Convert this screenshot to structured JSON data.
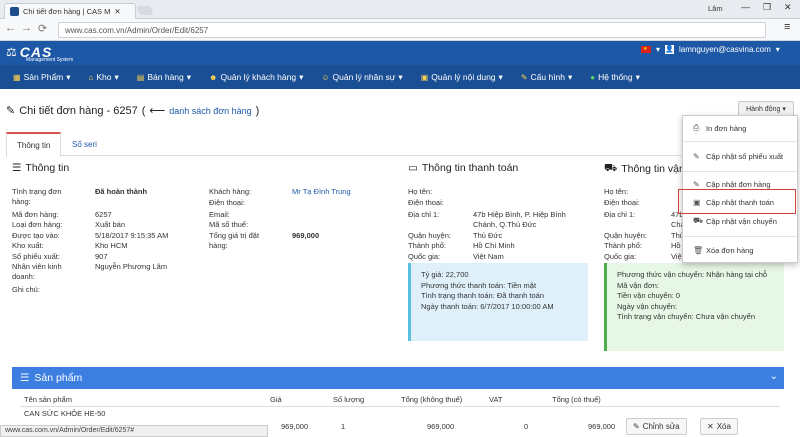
{
  "browser": {
    "tab_title": "Chi tiết đơn hàng | CAS M",
    "user": "Lâm",
    "url": "www.cas.com.vn/Admin/Order/Edit/6257",
    "status_url": "www.cas.com.vn/Admin/Order/Edit/6257#"
  },
  "app": {
    "logo": "CAS",
    "logo_sub": "Management System",
    "account": "lamnguyen@casvina.com"
  },
  "nav": [
    {
      "label": "Sản Phẩm"
    },
    {
      "label": "Kho"
    },
    {
      "label": "Bán hàng"
    },
    {
      "label": "Quản lý khách hàng"
    },
    {
      "label": "Quản lý nhân sự"
    },
    {
      "label": "Quản lý nội dung"
    },
    {
      "label": "Cấu hình"
    },
    {
      "label": "Hệ thống"
    }
  ],
  "page": {
    "title": "Chi tiết đơn hàng - 6257",
    "back_link": "danh sách đơn hàng",
    "action_button": "Hành động",
    "tabs": [
      "Thông tin",
      "Số seri"
    ]
  },
  "info": {
    "title": "Thông tin",
    "left": [
      {
        "label": "Tình trạng đơn hàng:",
        "value": "Đã hoàn thành"
      },
      {
        "label": "Mã đơn hàng:",
        "value": "6257"
      },
      {
        "label": "Loại đơn hàng:",
        "value": "Xuất bán"
      },
      {
        "label": "Được tạo vào:",
        "value": "5/18/2017 9:15:35 AM"
      },
      {
        "label": "Kho xuất:",
        "value": "Kho HCM"
      },
      {
        "label": "Số phiếu xuất:",
        "value": "907"
      },
      {
        "label": "Nhân viên kinh doanh:",
        "value": "Nguyễn Phương Lâm"
      },
      {
        "label": "Ghi chú:",
        "value": ""
      }
    ],
    "right": [
      {
        "label": "Khách hàng:",
        "value": "Mr Tạ Đình Trung"
      },
      {
        "label": "Điện thoại:",
        "value": ""
      },
      {
        "label": "Email:",
        "value": ""
      },
      {
        "label": "Mã số thuế:",
        "value": ""
      },
      {
        "label": "Tổng giá trị đặt hàng:",
        "value": "969,000"
      }
    ]
  },
  "payment": {
    "title": "Thông tin thanh toán",
    "fields": [
      {
        "label": "Họ tên:",
        "value": ""
      },
      {
        "label": "Điện thoại:",
        "value": ""
      },
      {
        "label": "Địa chỉ 1:",
        "value": "47b Hiệp Bình, P. Hiệp Bình Chánh, Q.Thủ Đức"
      },
      {
        "label": "Quận huyện:",
        "value": "Thủ Đức"
      },
      {
        "label": "Thành phố:",
        "value": "Hồ Chí Minh"
      },
      {
        "label": "Quốc gia:",
        "value": "Việt Nam"
      }
    ],
    "box": [
      "Tỷ giá: 22,700",
      "Phương thức thanh toán: Tiền mặt",
      "Tình trạng thanh toán: Đã thanh toán",
      "Ngày thanh toán: 6/7/2017 10:00:00 AM"
    ]
  },
  "shipping": {
    "title": "Thông tin vận",
    "fields": [
      {
        "label": "Họ tên:",
        "value": ""
      },
      {
        "label": "Điện thoại:",
        "value": ""
      },
      {
        "label": "Địa chỉ 1:",
        "value": "47b"
      },
      {
        "label": "",
        "value": "Chá"
      },
      {
        "label": "Quận huyện:",
        "value": "Thủ"
      },
      {
        "label": "Thành phố:",
        "value": "Hồ"
      },
      {
        "label": "Quốc gia:",
        "value": "Việt"
      }
    ],
    "box": [
      "Phương thức vận chuyển: Nhận hàng tại chỗ",
      "Mã vận đơn:",
      "Tiền vận chuyển: 0",
      "Ngày vận chuyển:",
      "Tình trạng vận chuyển: Chưa vận chuyển"
    ]
  },
  "dropdown": [
    {
      "label": "In đơn hàng",
      "icon": "print-icon"
    },
    {
      "label": "Cập nhật số phiếu xuất",
      "icon": "edit-icon"
    },
    {
      "label": "Cập nhật đơn hàng",
      "icon": "edit-icon"
    },
    {
      "label": "Cập nhật thanh toán",
      "icon": "money-icon"
    },
    {
      "label": "Cập nhật vận chuyển",
      "icon": "truck-icon"
    },
    {
      "label": "Xóa đơn hàng",
      "icon": "trash-icon"
    }
  ],
  "products": {
    "title": "Sản phẩm",
    "columns": [
      "Tên sản phẩm",
      "Giá",
      "Số lượng",
      "Tổng (không thuế)",
      "VAT",
      "Tổng (có thuế)"
    ],
    "rows": [
      {
        "name": "CAN SỨC KHỎE HE-50",
        "price": "969,000",
        "qty": "1",
        "subtotal": "969,000",
        "vat": "0",
        "total": "969,000"
      }
    ],
    "edit_label": "Chỉnh sửa",
    "delete_label": "Xóa"
  },
  "colors": {
    "header": "#1d58a7",
    "navbar": "#1b4f95",
    "highlight": "#d43f3a",
    "accent": "#3d7fe0"
  }
}
